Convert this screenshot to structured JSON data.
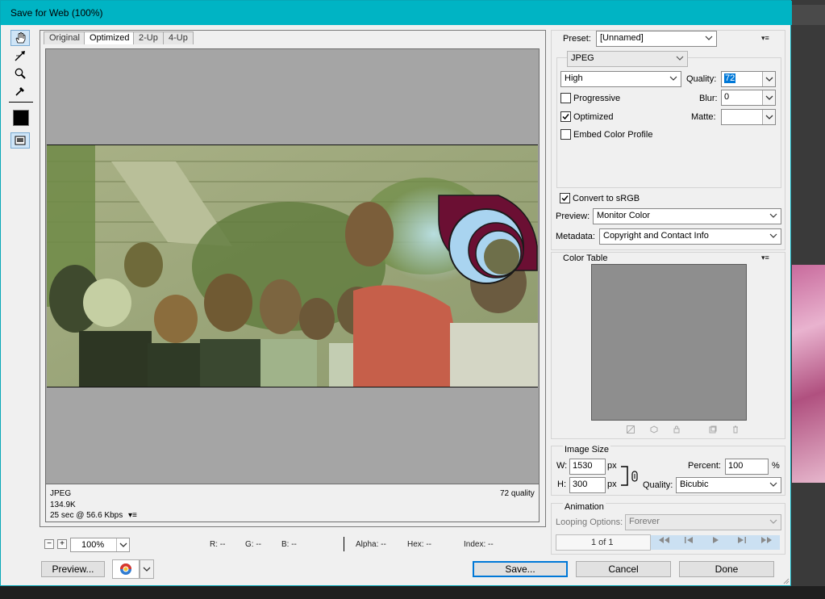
{
  "window": {
    "title": "Save for Web (100%)"
  },
  "tools": [
    "hand-tool",
    "slice-select-tool",
    "zoom-tool",
    "eyedropper-tool",
    "eyedropper-color",
    "toggle-slices-visibility"
  ],
  "tabs": [
    {
      "label": "Original",
      "selected": false
    },
    {
      "label": "Optimized",
      "selected": true
    },
    {
      "label": "2-Up",
      "selected": false
    },
    {
      "label": "4-Up",
      "selected": false
    }
  ],
  "canvas_info": {
    "format": "JPEG",
    "size": "134.9K",
    "time": "25 sec @ 56.6 Kbps",
    "quality": "72 quality",
    "menu_glyph": "▾≡"
  },
  "statusbar": {
    "zoom_minus": "−",
    "zoom_plus": "+",
    "zoom": "100%",
    "r": "R: --",
    "g": "G: --",
    "b": "B: --",
    "alpha": "Alpha: --",
    "hex": "Hex: --",
    "index": "Index: --"
  },
  "buttons": {
    "preview": "Preview...",
    "save": "Save...",
    "cancel": "Cancel",
    "done": "Done"
  },
  "settings": {
    "preset_label": "Preset:",
    "preset_value": "[Unnamed]",
    "format": "JPEG",
    "quality_level": "High",
    "quality_label": "Quality:",
    "quality_value": "72",
    "progressive": {
      "label": "Progressive",
      "checked": false
    },
    "blur_label": "Blur:",
    "blur_value": "0",
    "optimized": {
      "label": "Optimized",
      "checked": true
    },
    "matte_label": "Matte:",
    "embed_color_profile": {
      "label": "Embed Color Profile",
      "checked": false
    },
    "convert_srgb": {
      "label": "Convert to sRGB",
      "checked": true
    },
    "preview_label": "Preview:",
    "preview_value": "Monitor Color",
    "metadata_label": "Metadata:",
    "metadata_value": "Copyright and Contact Info",
    "menu_glyph": "▾≡"
  },
  "color_table": {
    "title": "Color Table",
    "menu_glyph": "▾≡"
  },
  "image_size": {
    "title": "Image Size",
    "w_label": "W:",
    "w_value": "1530",
    "h_label": "H:",
    "h_value": "300",
    "px": "px",
    "percent_label": "Percent:",
    "percent_value": "100",
    "percent_unit": "%",
    "quality_label": "Quality:",
    "quality_value": "Bicubic"
  },
  "animation": {
    "title": "Animation",
    "looping_label": "Looping Options:",
    "looping_value": "Forever",
    "frame_counter": "1 of 1"
  },
  "colors": {
    "titlebar": "#00b4c4",
    "accent": "#0078d7",
    "logo_maroon": "#6b0f33",
    "logo_light_blue": "#a9d4f0"
  }
}
